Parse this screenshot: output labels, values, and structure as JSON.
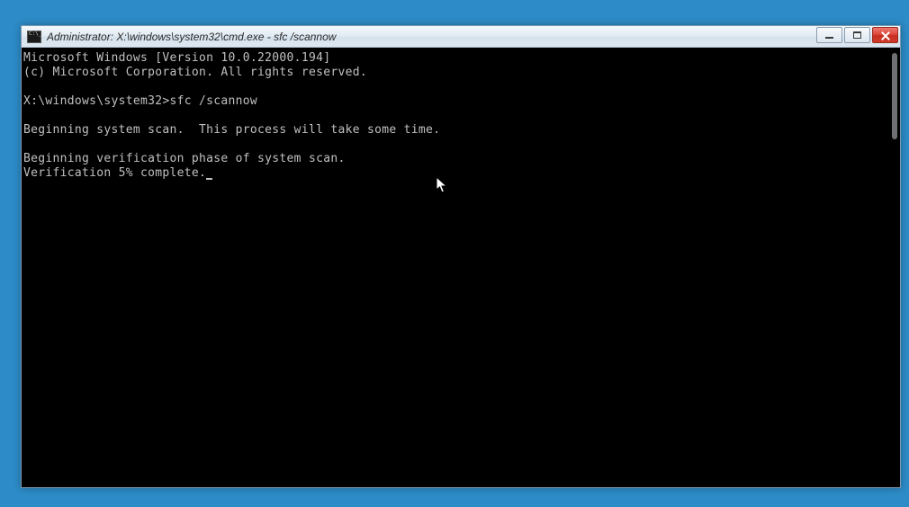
{
  "window": {
    "title": "Administrator: X:\\windows\\system32\\cmd.exe - sfc  /scannow"
  },
  "console": {
    "line1": "Microsoft Windows [Version 10.0.22000.194]",
    "line2": "(c) Microsoft Corporation. All rights reserved.",
    "blank1": "",
    "prompt_line": "X:\\windows\\system32>sfc /scannow",
    "blank2": "",
    "scan_line": "Beginning system scan.  This process will take some time.",
    "blank3": "",
    "verify_line": "Beginning verification phase of system scan.",
    "progress_line": "Verification 5% complete."
  }
}
